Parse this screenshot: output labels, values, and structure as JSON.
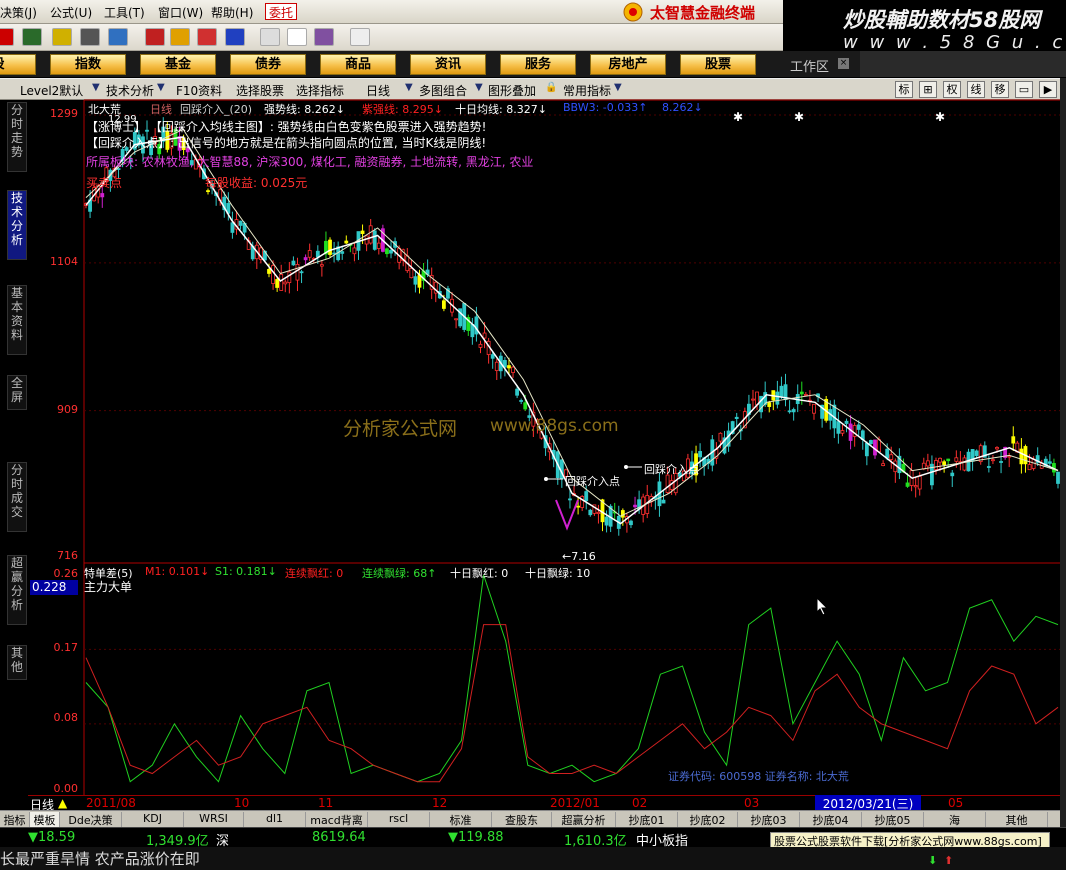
{
  "menubar": {
    "items": [
      "决策(J)",
      "公式(U)",
      "工具(T)",
      "窗口(W)",
      "帮助(H)"
    ],
    "trade_button": "委托",
    "brand": "太智慧金融终端"
  },
  "watermark": {
    "line1": "炒股輔助数材58股网",
    "line2": "w w w . 5 8 G u . c o m"
  },
  "nav": {
    "items": [
      "股",
      "指数",
      "基金",
      "债券",
      "商品",
      "资讯",
      "服务",
      "房地产",
      "股票"
    ],
    "workarea": "工作区"
  },
  "subbar": {
    "items": [
      "Level2默认",
      "技术分析",
      "F10资料",
      "选择股票",
      "选择指标",
      "日线",
      "多图组合",
      "图形叠加",
      "常用指标"
    ],
    "tools": [
      "标",
      "⊞",
      "权",
      "线",
      "移",
      "▭",
      "▶"
    ]
  },
  "left_tabs": [
    "分时走势",
    "技术分析",
    "基本资料",
    "全屏",
    "分时成交",
    "超赢分析",
    "其他"
  ],
  "main_header": {
    "stock": "北大荒",
    "period": "日线",
    "indicator": "回踩介入_(20)",
    "strong_label": "强势线: 8.262↓",
    "purple_label": "紫强线: 8.295↓",
    "ten_day": "十日均线: 8.327↓",
    "blue_label": "BBW3: -0.033↑",
    "tail_value": "8.262↓"
  },
  "notes": {
    "line1": "【涨博士】 【回踩介入均线主图】: 强势线由白色变紫色股票进入强势趋势!",
    "line2": "【回踩介入点】: 出信号的地方就是在箭头指向圆点的位置, 当时K线是阴线!",
    "sector_label": "所属板块: 农林牧渔, 大智慧88, 沪深300, 煤化工, 融资融券, 土地流转, 黑龙江, 农业",
    "trade_label": "买卖点",
    "profit_label": "每股收益: 0.025元"
  },
  "y_axis_main": [
    "1299",
    "1104",
    "909",
    "716"
  ],
  "y_axis_sub": [
    "0.26",
    "0.17",
    "0.08",
    "0.00"
  ],
  "price_labels": {
    "high": "12.99",
    "low": "←7.16"
  },
  "annotations": {
    "pullback1": "回踩介入点",
    "pullback2": "回踩介入点",
    "center_watermark": "分析家公式网",
    "center_url": "www.88gs.com"
  },
  "sub_header": {
    "name": "特单差(5)",
    "m1": "M1: 0.101↓",
    "s1": "S1: 0.181↓",
    "red_streak": "连续飘红: 0",
    "green_streak": "连续飘绿: 68↑",
    "ten_red": "十日飘红: 0",
    "ten_green": "十日飘绿: 10",
    "main_force": "主力大单",
    "current_value": "0.228",
    "stock_code": "证券代码: 600598   证券名称: 北大荒"
  },
  "date_axis": {
    "period": "日线",
    "labels": [
      "2011/08",
      "10",
      "11",
      "12",
      "2012/01",
      "02",
      "03",
      "05"
    ],
    "selected": "2012/03/21(三)"
  },
  "tabs": [
    "指标",
    "模板",
    "Dde决策",
    "KDJ",
    "WRSI",
    "dl1",
    "macd背离",
    "rscl",
    "标准",
    "查股东",
    "超赢分析",
    "抄底01",
    "抄底02",
    "抄底03",
    "抄底04",
    "抄底05",
    "海",
    "其他"
  ],
  "status": {
    "sh_change": "▼18.59",
    "sh_amount": "1,349.9亿",
    "sz_label": "深",
    "sz_index": "8619.64",
    "sz_change": "▼119.88",
    "sz_amount": "1,610.3亿",
    "sme_label": "中小板指"
  },
  "footer": {
    "ticker": "长最严重旱情 农产品涨价在即",
    "download": "股票公式股票软件下载[分析家公式网www.88gs.com]"
  },
  "chart_data": [
    {
      "type": "candlestick",
      "title": "北大荒 日线",
      "x": [
        "2011/08",
        "10",
        "11",
        "12",
        "2012/01",
        "02",
        "03",
        "05"
      ],
      "ylim": [
        7.16,
        12.99
      ],
      "y_ticks": [
        "1299",
        "1104",
        "909",
        "716"
      ],
      "series": [
        {
          "name": "强势线",
          "values": [
            11.8,
            12.6,
            12.7,
            11.6,
            10.8,
            11.2,
            11.4,
            10.8,
            10.2,
            9.3,
            8.0,
            7.6,
            8.1,
            8.6,
            9.3,
            9.2,
            8.7,
            8.2,
            8.4,
            8.6,
            8.3
          ]
        },
        {
          "name": "十日均线",
          "values": [
            11.9,
            12.5,
            12.8,
            11.8,
            10.9,
            11.1,
            11.5,
            10.9,
            10.4,
            9.5,
            8.2,
            7.7,
            8.0,
            8.5,
            9.2,
            9.3,
            8.9,
            8.3,
            8.4,
            8.5,
            8.3
          ]
        }
      ],
      "annotations": [
        "12.99",
        "7.16",
        "回踩介入点",
        "回踩介入点"
      ]
    },
    {
      "type": "line",
      "title": "特单差(5) 主力大单",
      "ylim": [
        0,
        0.26
      ],
      "y_ticks": [
        "0.26",
        "0.17",
        "0.08",
        "0.00"
      ],
      "series": [
        {
          "name": "M1",
          "values": [
            0.16,
            0.1,
            0.03,
            0.02,
            0.04,
            0.06,
            0.03,
            0.04,
            0.08,
            0.09,
            0.1,
            0.06,
            0.05,
            0.03,
            0.02,
            0.01,
            0.01,
            0.05,
            0.2,
            0.2,
            0.04,
            0.02,
            0.02,
            0.03,
            0.02,
            0.04,
            0.06,
            0.08,
            0.05,
            0.07,
            0.1,
            0.09,
            0.06,
            0.12,
            0.14,
            0.1,
            0.08,
            0.07,
            0.06,
            0.05,
            0.12,
            0.15,
            0.14,
            0.08,
            0.1
          ]
        },
        {
          "name": "S1",
          "values": [
            0.13,
            0.1,
            0.01,
            0.03,
            0.08,
            0.04,
            0.01,
            0.09,
            0.05,
            0.02,
            0.12,
            0.13,
            0.02,
            0.03,
            0.02,
            0.01,
            0.02,
            0.06,
            0.26,
            0.18,
            0.03,
            0.02,
            0.03,
            0.01,
            0.02,
            0.05,
            0.14,
            0.15,
            0.07,
            0.03,
            0.2,
            0.22,
            0.08,
            0.13,
            0.18,
            0.14,
            0.06,
            0.16,
            0.12,
            0.13,
            0.22,
            0.23,
            0.18,
            0.21,
            0.2
          ]
        }
      ]
    }
  ]
}
